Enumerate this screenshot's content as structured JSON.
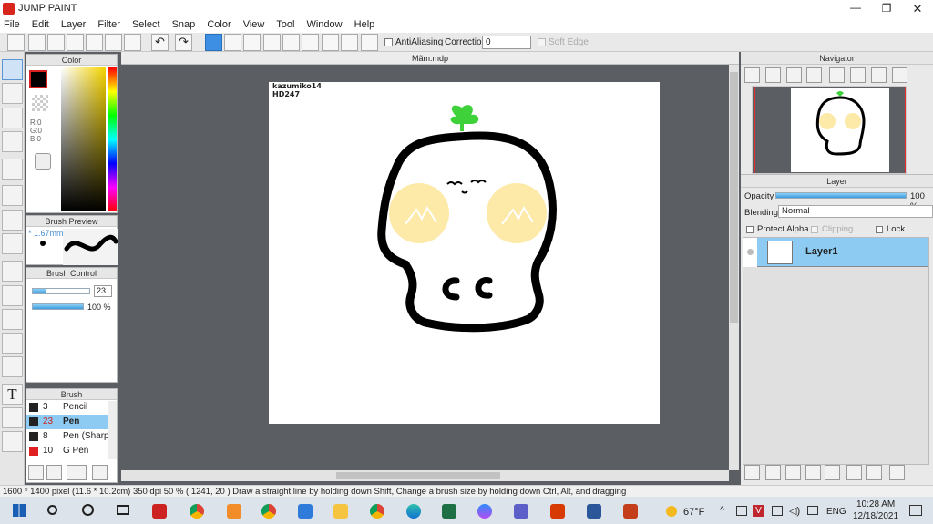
{
  "app": {
    "title": "JUMP PAINT"
  },
  "menu": [
    "File",
    "Edit",
    "Layer",
    "Filter",
    "Select",
    "Snap",
    "Color",
    "View",
    "Tool",
    "Window",
    "Help"
  ],
  "toolbar": {
    "antialias_label": "AntiAliasing",
    "correction_label": "Correction",
    "correction_value": "0",
    "soft_edge_label": "Soft Edge"
  },
  "document": {
    "tab_title": "Mãm.mdp",
    "artist_credit_line1": "kazumiko14",
    "artist_credit_line2": "HD247"
  },
  "color_panel": {
    "title": "Color",
    "r": "R:0",
    "g": "G:0",
    "b": "B:0",
    "fg": "#000000"
  },
  "brush_preview": {
    "title": "Brush Preview",
    "size": "* 1.67mm"
  },
  "brush_control": {
    "title": "Brush Control",
    "size_value": "23",
    "size_fraction": 0.23,
    "opacity_value": "100 %",
    "opacity_fraction": 1.0
  },
  "brush_list": {
    "title": "Brush",
    "items": [
      {
        "num": "3",
        "name": "Pencil",
        "color": "#222222"
      },
      {
        "num": "23",
        "name": "Pen",
        "color": "#222222"
      },
      {
        "num": "8",
        "name": "Pen (Sharp",
        "color": "#222222"
      },
      {
        "num": "10",
        "name": "G Pen",
        "color": "#e02020"
      }
    ]
  },
  "navigator": {
    "title": "Navigator"
  },
  "layer_panel": {
    "title": "Layer",
    "opacity_label": "Opacity",
    "opacity_value": "100 %",
    "opacity_fraction": 1.0,
    "blending_label": "Blending",
    "blending_value": "Normal",
    "protect_alpha": "Protect Alpha",
    "clipping": "Clipping",
    "lock": "Lock",
    "layers": [
      {
        "name": "Layer1"
      }
    ]
  },
  "status": {
    "text": "1600 * 1400 pixel   (11.6 * 10.2cm)   350 dpi   50 %   ( 1241, 20 )   Draw a straight line by holding down Shift, Change a brush size by holding down Ctrl, Alt, and dragging"
  },
  "taskbar": {
    "weather": "67°F",
    "lang": "ENG",
    "time": "10:28 AM",
    "date": "12/18/2021"
  }
}
